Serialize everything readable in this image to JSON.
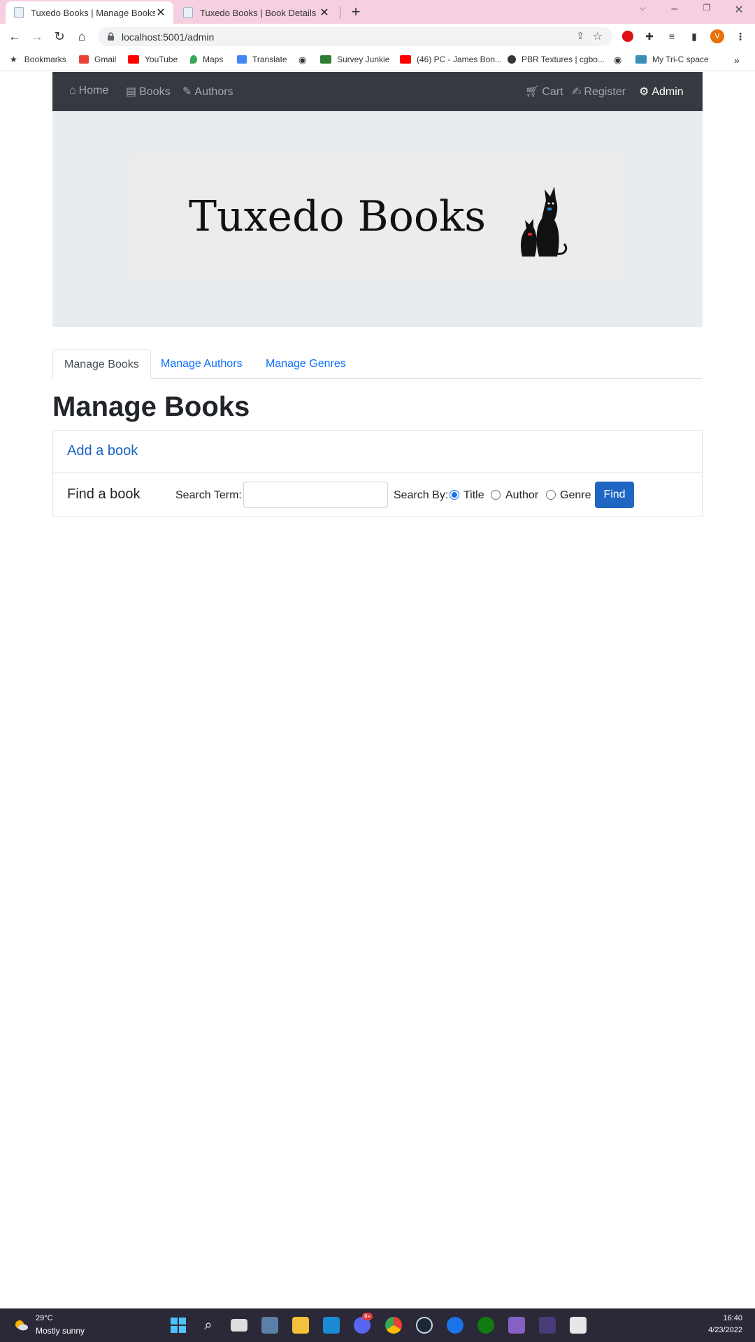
{
  "browser": {
    "tabs": [
      {
        "title": "Tuxedo Books | Manage Books",
        "active": true
      },
      {
        "title": "Tuxedo Books | Book Details",
        "active": false
      }
    ],
    "url": "localhost:5001/admin",
    "profile_initial": "V",
    "bookmarks": [
      "Bookmarks",
      "Gmail",
      "YouTube",
      "Maps",
      "Translate",
      "Survey Junkie",
      "(46) PC - James Bon...",
      "PBR Textures | cgbo...",
      "My Tri-C space"
    ]
  },
  "site": {
    "nav_left": [
      "Home",
      "Books",
      "Authors"
    ],
    "nav_right": [
      "Cart",
      "Register",
      "Admin"
    ],
    "logo_text": "Tuxedo Books",
    "admin_tabs": [
      "Manage Books",
      "Manage Authors",
      "Manage Genres"
    ],
    "page_title": "Manage Books",
    "add_link": "Add a book",
    "find_title": "Find a book",
    "search_term_label": "Search Term:",
    "search_value": "",
    "search_by_label": "Search By:",
    "search_options": [
      "Title",
      "Author",
      "Genre"
    ],
    "selected_option": "Title",
    "find_button": "Find"
  },
  "taskbar": {
    "temperature": "29°C",
    "weather": "Mostly sunny",
    "time": "16:40",
    "date": "4/23/2022",
    "badge": "9+"
  },
  "colors": {
    "tabstrip": "#f6cfe0",
    "navbar": "#343a40",
    "link": "#0d6efd",
    "button": "#1e66c2",
    "taskbar": "#2b2838"
  }
}
